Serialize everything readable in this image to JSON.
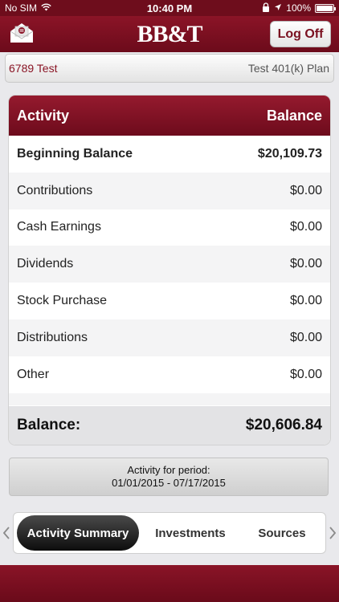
{
  "status_bar": {
    "carrier": "No SIM",
    "time": "10:40 PM",
    "battery": "100%",
    "battery_level": 1.0
  },
  "header": {
    "logo": "BB&T",
    "logoff_label": "Log Off"
  },
  "account": {
    "name": "6789 Test",
    "plan": "Test 401(k) Plan"
  },
  "table": {
    "col_activity": "Activity",
    "col_balance": "Balance",
    "rows": [
      {
        "label": "Beginning Balance",
        "value": "$20,109.73"
      },
      {
        "label": "Contributions",
        "value": "$0.00"
      },
      {
        "label": "Cash Earnings",
        "value": "$0.00"
      },
      {
        "label": "Dividends",
        "value": "$0.00"
      },
      {
        "label": "Stock Purchase",
        "value": "$0.00"
      },
      {
        "label": "Distributions",
        "value": "$0.00"
      },
      {
        "label": "Other",
        "value": "$0.00"
      }
    ],
    "total_label": "Balance:",
    "total_value": "$20,606.84"
  },
  "period": {
    "line1": "Activity for period:",
    "line2": "01/01/2015 - 07/17/2015"
  },
  "tabs": [
    {
      "label": "Activity Summary"
    },
    {
      "label": "Investments"
    },
    {
      "label": "Sources"
    }
  ],
  "colors": {
    "brand": "#7a1020",
    "active_tab": "#1a1a1a"
  },
  "icons": {
    "mail": "mail-icon",
    "wifi": "wifi-icon",
    "lock": "lock-icon",
    "location": "location-icon"
  }
}
